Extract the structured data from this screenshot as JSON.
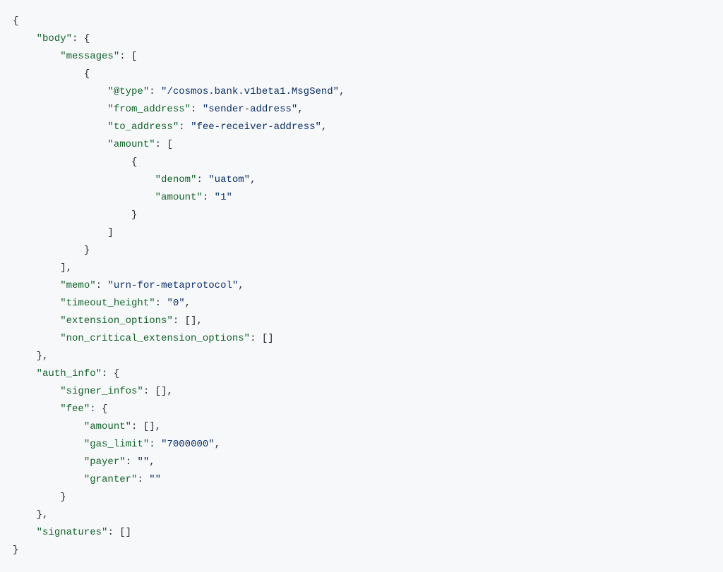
{
  "keys": {
    "body": "\"body\"",
    "messages": "\"messages\"",
    "type": "\"@type\"",
    "from_address": "\"from_address\"",
    "to_address": "\"to_address\"",
    "amount": "\"amount\"",
    "denom": "\"denom\"",
    "memo": "\"memo\"",
    "timeout_height": "\"timeout_height\"",
    "extension_options": "\"extension_options\"",
    "non_critical_extension_options": "\"non_critical_extension_options\"",
    "auth_info": "\"auth_info\"",
    "signer_infos": "\"signer_infos\"",
    "fee": "\"fee\"",
    "gas_limit": "\"gas_limit\"",
    "payer": "\"payer\"",
    "granter": "\"granter\"",
    "signatures": "\"signatures\""
  },
  "vals": {
    "type": "\"/cosmos.bank.v1beta1.MsgSend\"",
    "from_address": "\"sender-address\"",
    "to_address": "\"fee-receiver-address\"",
    "denom": "\"uatom\"",
    "amount_val": "\"1\"",
    "memo": "\"urn-for-metaprotocol\"",
    "timeout_height": "\"0\"",
    "gas_limit": "\"7000000\"",
    "empty": "\"\""
  },
  "punct": {
    "obrace": "{",
    "cbrace": "}",
    "cbrace_c": "},",
    "obracket": "[",
    "cbracket": "]",
    "cbracket_c": "],",
    "colon_sp": ": ",
    "colon_obrace": ": {",
    "colon_obracket": ": [",
    "colon_ebrackets": ": [],",
    "colon_ebrackets_nc": ": []",
    "comma": ","
  }
}
